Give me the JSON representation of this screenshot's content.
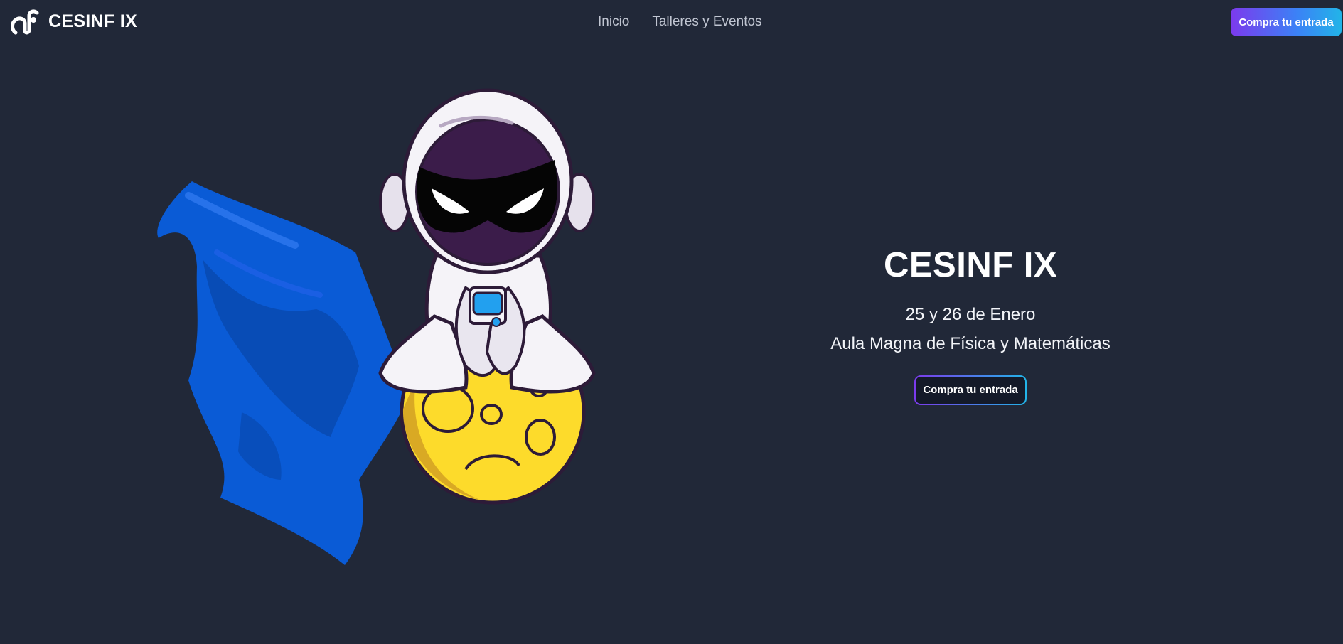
{
  "nav": {
    "brand": "CESINF IX",
    "links": [
      "Inicio",
      "Talleres y Eventos"
    ],
    "cta_label": "Compra tu entrada"
  },
  "hero": {
    "title": "CESINF IX",
    "date": "25 y 26 de Enero",
    "place": "Aula Magna de Física y Matemáticas",
    "cta_label": "Compra tu entrada",
    "illustration": "astronaut-superhero-on-moon"
  },
  "colors": {
    "background": "#212838",
    "accent_start": "#7c3aed",
    "accent_end": "#22b4e8",
    "cape_blue": "#0a5bd6",
    "moon_yellow": "#fddb2b",
    "helmet_purple": "#3b1c4a"
  }
}
